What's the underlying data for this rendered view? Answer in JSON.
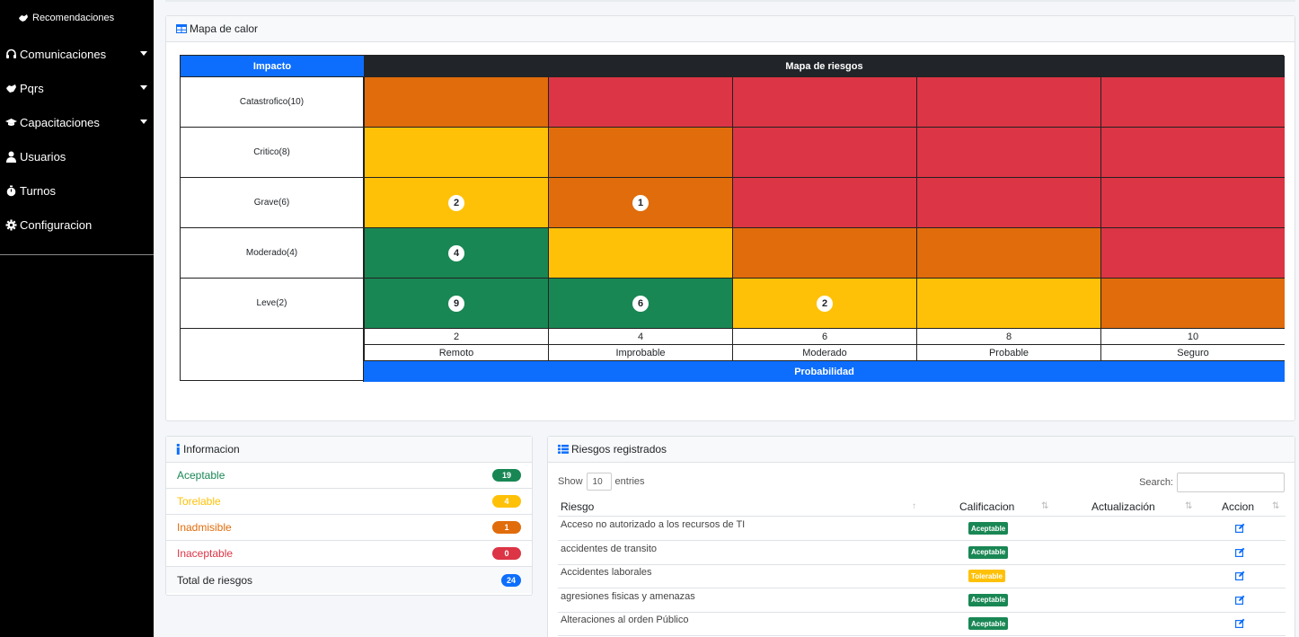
{
  "sidebar": {
    "top": {
      "label": "Recomendaciones",
      "icon": "handshake-icon"
    },
    "items": [
      {
        "label": "Comunicaciones",
        "icon": "headset-icon",
        "caret": true
      },
      {
        "label": "Pqrs",
        "icon": "handshake-icon",
        "caret": true
      },
      {
        "label": "Capacitaciones",
        "icon": "graduation-cap-icon",
        "caret": true
      },
      {
        "label": "Usuarios",
        "icon": "user-icon",
        "caret": false
      },
      {
        "label": "Turnos",
        "icon": "stopwatch-icon",
        "caret": false
      },
      {
        "label": "Configuracion",
        "icon": "gear-icon",
        "caret": false
      }
    ]
  },
  "heatmap": {
    "title": "Mapa de calor",
    "impact_header": "Impacto",
    "map_header": "Mapa de riesgos",
    "rows": [
      {
        "label": "Catastrofico(10)",
        "cells": [
          {
            "color": "orange",
            "count": ""
          },
          {
            "color": "red",
            "count": ""
          },
          {
            "color": "red",
            "count": ""
          },
          {
            "color": "red",
            "count": ""
          },
          {
            "color": "red",
            "count": ""
          }
        ]
      },
      {
        "label": "Critico(8)",
        "cells": [
          {
            "color": "yellow",
            "count": ""
          },
          {
            "color": "orange",
            "count": ""
          },
          {
            "color": "red",
            "count": ""
          },
          {
            "color": "red",
            "count": ""
          },
          {
            "color": "red",
            "count": ""
          }
        ]
      },
      {
        "label": "Grave(6)",
        "cells": [
          {
            "color": "yellow",
            "count": "2"
          },
          {
            "color": "orange",
            "count": "1"
          },
          {
            "color": "red",
            "count": ""
          },
          {
            "color": "red",
            "count": ""
          },
          {
            "color": "red",
            "count": ""
          }
        ]
      },
      {
        "label": "Moderado(4)",
        "cells": [
          {
            "color": "green",
            "count": "4"
          },
          {
            "color": "yellow",
            "count": ""
          },
          {
            "color": "orange",
            "count": ""
          },
          {
            "color": "orange",
            "count": ""
          },
          {
            "color": "red",
            "count": ""
          }
        ]
      },
      {
        "label": "Leve(2)",
        "cells": [
          {
            "color": "green",
            "count": "9"
          },
          {
            "color": "green",
            "count": "6"
          },
          {
            "color": "yellow",
            "count": "2"
          },
          {
            "color": "yellow",
            "count": ""
          },
          {
            "color": "orange",
            "count": ""
          }
        ]
      }
    ],
    "probability_values": [
      "2",
      "4",
      "6",
      "8",
      "10"
    ],
    "probability_labels": [
      "Remoto",
      "Improbable",
      "Moderado",
      "Probable",
      "Seguro"
    ],
    "probability_header": "Probabilidad"
  },
  "info": {
    "title": "Informacion",
    "items": [
      {
        "label": "Aceptable",
        "count": "19",
        "color": "#198754"
      },
      {
        "label": "Torelable",
        "count": "4",
        "color": "#ffc107"
      },
      {
        "label": "Inadmisible",
        "count": "1",
        "color": "#e06c0b"
      },
      {
        "label": "Inaceptable",
        "count": "0",
        "color": "#dc3545"
      }
    ],
    "total_label": "Total de riesgos",
    "total_count": "24",
    "total_color": "#0d6efd"
  },
  "risks": {
    "title": "Riesgos registrados",
    "show_label": "Show",
    "length_value": "10",
    "entries_label": "entries",
    "search_label": "Search:",
    "columns": [
      "Riesgo",
      "Calificacion",
      "Actualización",
      "Accion"
    ],
    "rows": [
      {
        "riesgo": "Acceso no autorizado a los recursos de TI",
        "calificacion": "Aceptable",
        "badge_color": "#198754"
      },
      {
        "riesgo": "accidentes de transito",
        "calificacion": "Aceptable",
        "badge_color": "#198754"
      },
      {
        "riesgo": "Accidentes laborales",
        "calificacion": "Tolerable",
        "badge_color": "#ffc107"
      },
      {
        "riesgo": "agresiones fisicas y amenazas",
        "calificacion": "Aceptable",
        "badge_color": "#198754"
      },
      {
        "riesgo": "Alteraciones al orden Público",
        "calificacion": "Aceptable",
        "badge_color": "#198754"
      }
    ]
  },
  "colors": {
    "orange": "#e06c0b",
    "red": "#dc3545",
    "yellow": "#ffc107",
    "green": "#198754",
    "primary": "#0d6efd"
  }
}
